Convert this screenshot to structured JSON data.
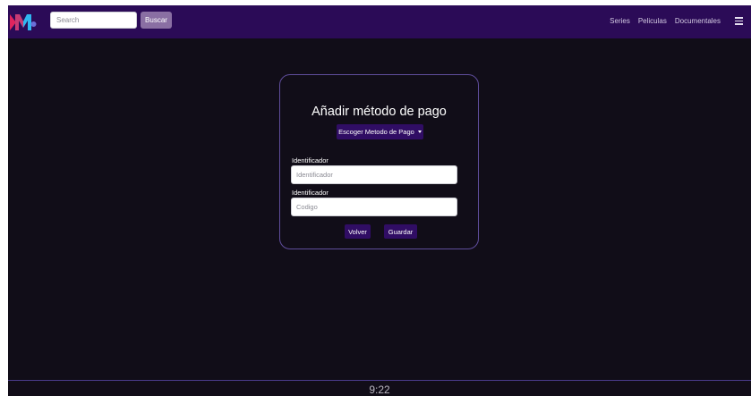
{
  "navbar": {
    "logo_text": "DMB",
    "search": {
      "placeholder": "Search",
      "value": ""
    },
    "search_button_label": "Buscar",
    "links": [
      "Series",
      "Peliculas",
      "Documentales"
    ],
    "menu_icon": "hamburger-icon",
    "colors": {
      "background": "#2b0b57",
      "button": "#8a6fa3"
    }
  },
  "form": {
    "title": "Añadir método de pago",
    "method_dropdown_label": "Escoger Metodo de Pago",
    "fields": [
      {
        "label": "Identificador",
        "placeholder": "Identificador",
        "value": ""
      },
      {
        "label": "Identificador",
        "placeholder": "Codigo",
        "value": ""
      }
    ],
    "back_button_label": "Volver",
    "save_button_label": "Guardar",
    "colors": {
      "border": "#5f4d9c",
      "button": "#300d64"
    }
  },
  "footer": {
    "time": "9:22"
  }
}
